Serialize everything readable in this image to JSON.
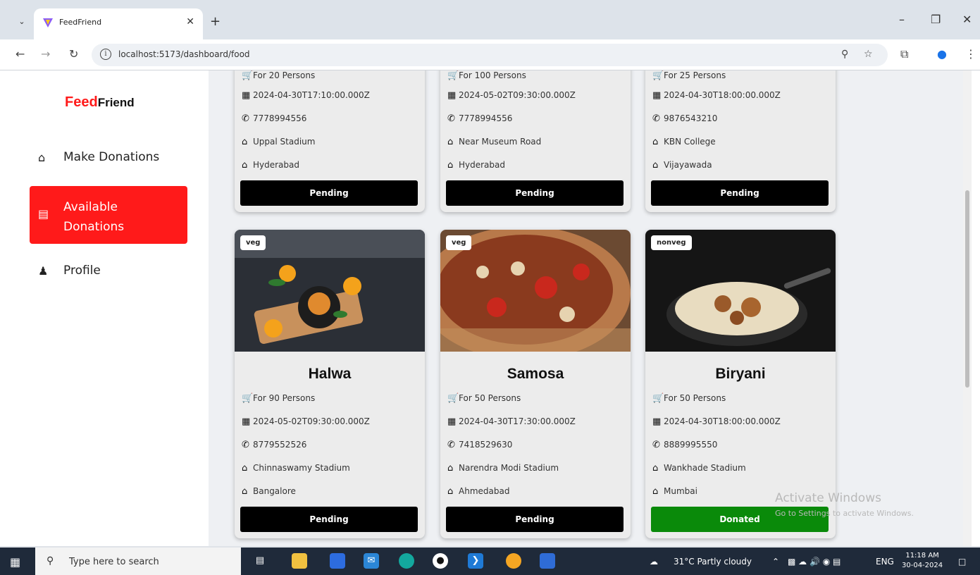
{
  "browser": {
    "tab_title": "FeedFriend",
    "url": "localhost:5173/dashboard/food"
  },
  "brand": {
    "part1": "Feed",
    "part2": "Friend"
  },
  "sidebar": {
    "items": [
      {
        "label": "Make Donations",
        "icon": "home-icon"
      },
      {
        "label": "Available Donations",
        "icon": "list-icon",
        "active": true
      },
      {
        "label": "Profile",
        "icon": "user-icon"
      }
    ]
  },
  "top_cards": [
    {
      "persons": "For 20 Persons",
      "datetime": "2024-04-30T17:10:00.000Z",
      "phone": "7778994556",
      "address": "Uppal Stadium",
      "city": "Hyderabad",
      "status": "Pending"
    },
    {
      "persons": "For 100 Persons",
      "datetime": "2024-05-02T09:30:00.000Z",
      "phone": "7778994556",
      "address": "Near Museum Road",
      "city": "Hyderabad",
      "status": "Pending"
    },
    {
      "persons": "For 25 Persons",
      "datetime": "2024-04-30T18:00:00.000Z",
      "phone": "9876543210",
      "address": "KBN College",
      "city": "Vijayawada",
      "status": "Pending"
    }
  ],
  "cards": [
    {
      "tag": "veg",
      "title": "Halwa",
      "persons": "For 90 Persons",
      "datetime": "2024-05-02T09:30:00.000Z",
      "phone": "8779552526",
      "address": "Chinnaswamy Stadium",
      "city": "Bangalore",
      "status": "Pending"
    },
    {
      "tag": "veg",
      "title": "Samosa",
      "persons": "For 50 Persons",
      "datetime": "2024-04-30T17:30:00.000Z",
      "phone": "7418529630",
      "address": "Narendra Modi Stadium",
      "city": "Ahmedabad",
      "status": "Pending"
    },
    {
      "tag": "nonveg",
      "title": "Biryani",
      "persons": "For 50 Persons",
      "datetime": "2024-04-30T18:00:00.000Z",
      "phone": "8889995550",
      "address": "Wankhade Stadium",
      "city": "Mumbai",
      "status": "Donated"
    }
  ],
  "colors": {
    "brand_red": "#ff1a1a",
    "pending": "#000000",
    "donated": "#0a8a0a"
  },
  "watermark": {
    "line1": "Activate Windows",
    "line2": "Go to Settings to activate Windows."
  },
  "taskbar": {
    "search_placeholder": "Type here to search",
    "weather": "31°C  Partly cloudy",
    "lang": "ENG",
    "time": "11:18 AM",
    "date": "30-04-2024"
  }
}
